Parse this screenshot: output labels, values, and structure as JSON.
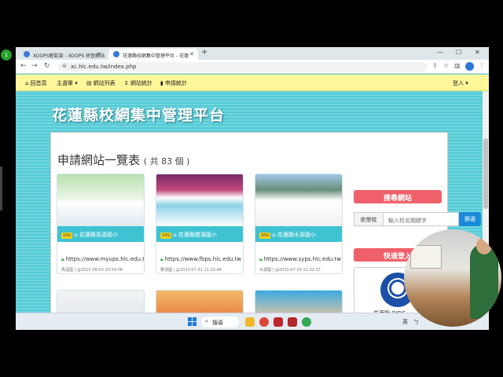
{
  "browser": {
    "tabs": [
      {
        "title": "XOOPS輕鬆架 - XOOPS 研習網站"
      },
      {
        "title": "花蓮縣校網集中管理平台 - 花蓮"
      }
    ],
    "new_tab": "+",
    "url": "xc.hlc.edu.tw/index.php",
    "window_controls": [
      "—",
      "☐",
      "✕"
    ]
  },
  "recording_badge": "1",
  "menu": {
    "items": [
      {
        "label": "回首頁",
        "icon": "home-icon"
      },
      {
        "label": "主選單",
        "icon": "menu-icon"
      },
      {
        "label": "網站列表",
        "icon": "list-icon"
      },
      {
        "label": "網站統計",
        "icon": "chart-icon"
      },
      {
        "label": "申請統計",
        "icon": "bar-chart-icon"
      }
    ],
    "login": "登入"
  },
  "site_title": "花蓮縣校網集中管理平台",
  "list": {
    "title": "申請網站一覽表",
    "count_text": "( 共 83 個 )"
  },
  "cards": [
    {
      "name": "花蓮縣馬遠國小",
      "badge": "10G",
      "url": "https://www.myups.hlc.edu.t",
      "meta": "馬遠國 | @2023-08-03 10:59:08"
    },
    {
      "name": "花蓮縣豐濱國小",
      "badge": "10G",
      "url": "https://www.fbps.hlc.edu.tw",
      "meta": "豐濱國 | @2023-07-31 11:32:46"
    },
    {
      "name": "花蓮縣水源國小",
      "badge": "10G",
      "url": "https://www.syps.hlc.edu.tw",
      "meta": "水源國 | @2023-07-24 11:32:37"
    }
  ],
  "sidebar": {
    "search_header": "搜尋網站",
    "search_label": "依學校",
    "search_placeholder": "輸入校名關鍵字",
    "search_button": "篩選",
    "login_header": "快速登入",
    "oidc_label": "花蓮縣 OIDC"
  },
  "taskbar": {
    "search": "搜尋",
    "tray": [
      "英",
      "ㄅ"
    ]
  },
  "colors": {
    "menu_bg": "#fff79a",
    "page_bg": "#5ad0dc",
    "sidebar_header": "#f0606a",
    "card_bar": "#3fc3d3",
    "search_button": "#1a8ad8"
  }
}
